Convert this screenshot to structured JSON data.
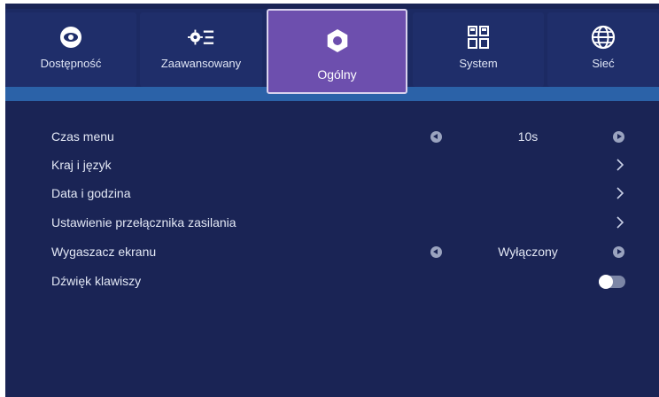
{
  "tabs": [
    {
      "label": "Dostępność",
      "icon": "eye-icon",
      "active": false
    },
    {
      "label": "Zaawansowany",
      "icon": "advanced-settings-icon",
      "active": false
    },
    {
      "label": "Ogólny",
      "icon": "gear-icon",
      "active": true
    },
    {
      "label": "System",
      "icon": "system-grid-icon",
      "active": false
    },
    {
      "label": "Sieć",
      "icon": "globe-icon",
      "active": false
    }
  ],
  "settings": [
    {
      "label": "Czas menu",
      "control": "selector",
      "value": "10s"
    },
    {
      "label": "Kraj i język",
      "control": "submenu"
    },
    {
      "label": "Data i godzina",
      "control": "submenu"
    },
    {
      "label": "Ustawienie przełącznika zasilania",
      "control": "submenu"
    },
    {
      "label": "Wygaszacz ekranu",
      "control": "selector",
      "value": "Wyłączony"
    },
    {
      "label": "Dźwięk klawiszy",
      "control": "toggle",
      "enabled": false
    }
  ],
  "colors": {
    "background": "#1a2455",
    "tab_strip": "#1c2a63",
    "tab_underline": "#2b62a8",
    "active_tab": "#6d4fae",
    "text": "#e3e8f5"
  }
}
